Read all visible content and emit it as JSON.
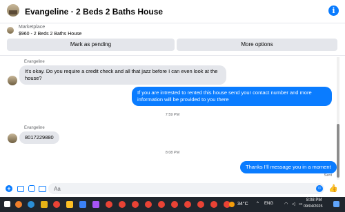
{
  "header": {
    "title": "Evangeline · 2 Beds 2 Baths House",
    "info_icon": "info-icon"
  },
  "marketplace": {
    "label": "Marketplace",
    "item": "$960 - 2 Beds 2 Baths House",
    "mark_pending": "Mark as pending",
    "more_options": "More options"
  },
  "messages": [
    {
      "sender": "Evangeline",
      "text_line1": "It's okay.  Do you require a credit check and all that jazz before I can even look at the",
      "text_line2": "house?"
    },
    {
      "text_line1": "If you are intrested to rented this house send your contact number and more",
      "text_line2": "information will be provided to you there"
    },
    {
      "time": "7:59 PM"
    },
    {
      "sender": "Evangeline",
      "text": "8017229880"
    },
    {
      "time": "8:08 PM"
    },
    {
      "text": "Thanks I'll message you in a moment",
      "status": "Sent"
    }
  ],
  "composer": {
    "placeholder": "Aa"
  },
  "taskbar": {
    "temperature": "34°C",
    "time": "8:08 PM",
    "date": "09/04/2025",
    "language": "ENG"
  }
}
